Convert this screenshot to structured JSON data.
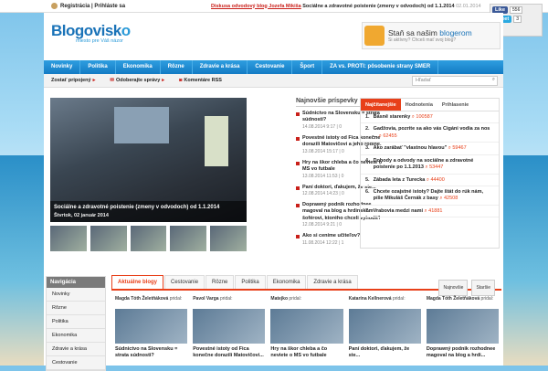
{
  "topbar": {
    "registration": "Registrácia | Prihláste sa",
    "ticker_highlight": "Diskusa odvodový blog Jozefa Mikiša",
    "ticker_text": " Sociálne a zdravotné poistenie (zmeny v odvodoch) od 1.1.2014",
    "ticker_date": "02.01.2014"
  },
  "social": {
    "like_label": "Like",
    "like_count": "556",
    "tweet_label": "Tweet",
    "tweet_count": "3",
    "google_label": "+1"
  },
  "logo": {
    "text_main": "Blogovisk",
    "text_o": "o",
    "slogan": "miesto pre Váš názor"
  },
  "promo": {
    "heading_prefix": "Staň sa našim ",
    "heading_link": "blogerom",
    "subtext": "Si aktívny? Chceš mať svoj blog?"
  },
  "nav": [
    "Novinky",
    "Politika",
    "Ekonomika",
    "Rôzne",
    "Zdravie a krása",
    "Cestovanie",
    "Šport",
    "ZA vs. PROTI: pôsobenie strany SMER"
  ],
  "subnav": {
    "items": [
      "Zostať pripojený",
      "Odoberajte správy",
      "Komentáre RSS"
    ],
    "search_placeholder": "Hľadať"
  },
  "slider": {
    "caption_title": "Sociálne a zdravotné poistenie (zmeny v odvodoch) od 1.1.2014",
    "caption_date": "Štvrtok, 02 január 2014"
  },
  "newest": {
    "heading": "Najnovšie príspevky",
    "items": [
      {
        "title": "Súdnictvo na Slovensku = strata súdnosti?",
        "date": "14.08.2014 9:17 | 0"
      },
      {
        "title": "Povestné istoty od Fica konečne dorazili Matovičovi a jeho rodine.",
        "date": "13.08.2014 15:17 | 0"
      },
      {
        "title": "Hry na škor chleba a čo neviete o MS vo futbale",
        "date": "13.08.2014 11:53 | 0"
      },
      {
        "title": "Paní doktori, ďakujem, že ste...",
        "date": "12.08.2014 14:23 | 0"
      },
      {
        "title": "Doprawný podnik rozhodnee magoval na blog a hrdinskom šoférovi, ktorého chceli vyhodiť!",
        "date": "12.08.2014 9:21 | 0"
      },
      {
        "title": "Ako si ceníme učiteľov?",
        "date": "11.08.2014 12:22 | 1"
      }
    ]
  },
  "tops": {
    "tabs": [
      "Najčítanejšie",
      "Hodnotenia",
      "Prihlasenie"
    ],
    "items": [
      {
        "n": "1.",
        "title": "Básně starenky",
        "views": "100587"
      },
      {
        "n": "2.",
        "title": "Gadžovia, pozrite sa ako vás Cigáni vodia za nos ...",
        "views": "62455"
      },
      {
        "n": "3.",
        "title": "Ako zarábať \"vlastnou hlavou\"",
        "views": "59467"
      },
      {
        "n": "4.",
        "title": "Dohody a odvody na sociálne a zdravotné poistenie po 1.1.2013",
        "views": "53447"
      },
      {
        "n": "5.",
        "title": "Zábada leta z Turecka",
        "views": "44400"
      },
      {
        "n": "6.",
        "title": "Chcete ozajstné istoty? Dajte štát do rúk nám, píše Mikuláš Černák z basy",
        "views": "42508"
      },
      {
        "n": "7.",
        "title": "Vrabovia medzi nami",
        "views": "41881"
      }
    ]
  },
  "sidebar": {
    "heading": "Navigácia",
    "items": [
      "Novinky",
      "Rôzne",
      "Politika",
      "Ekonomika",
      "Zdravie a krása",
      "Cestovanie"
    ]
  },
  "blogs": {
    "tabs": [
      "Aktuálne blogy",
      "Cestovanie",
      "Rôzne",
      "Politika",
      "Ekonomika",
      "Zdravie a krása"
    ],
    "sort": [
      "Najnovšie",
      "Staršie"
    ],
    "cards": [
      {
        "author": "Magda Tóth Želetňáková",
        "action": " pridal:",
        "title": "Súdnictvo na Slovensku = strata súdnosti?"
      },
      {
        "author": "Pavol Varga",
        "action": " pridal:",
        "title": "Povestné istoty od Fica konečne dorazili Matovičovi..."
      },
      {
        "author": "Matejko",
        "action": " pridal:",
        "title": "Hry na škor chleba a čo neviete o MS vo futbale"
      },
      {
        "author": "Katarína Kellnerová",
        "action": " pridal:",
        "title": "Paní doktori, ďakujem, že ste..."
      },
      {
        "author": "Magda Tóth Želetňáková",
        "action": " pridal:",
        "title": "Doprawný podnik rozhodnee magoval na blog a hrdi..."
      }
    ]
  }
}
